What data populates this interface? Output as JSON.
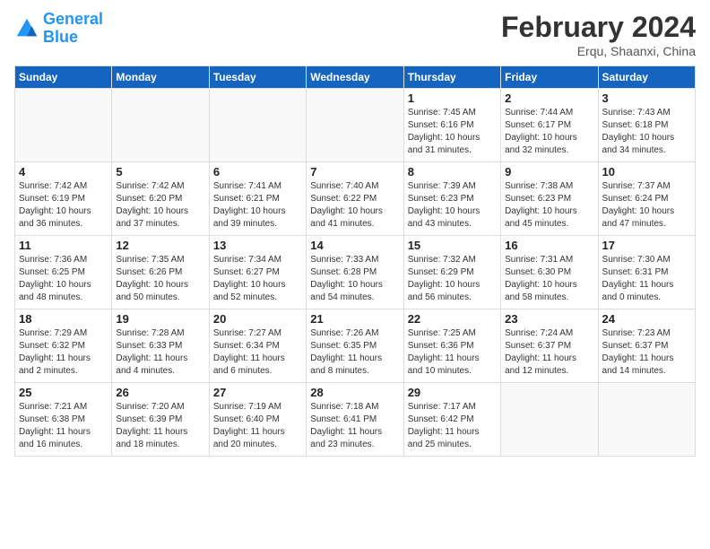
{
  "header": {
    "logo_line1": "General",
    "logo_line2": "Blue",
    "month": "February 2024",
    "location": "Erqu, Shaanxi, China"
  },
  "weekdays": [
    "Sunday",
    "Monday",
    "Tuesday",
    "Wednesday",
    "Thursday",
    "Friday",
    "Saturday"
  ],
  "weeks": [
    [
      {
        "day": "",
        "info": ""
      },
      {
        "day": "",
        "info": ""
      },
      {
        "day": "",
        "info": ""
      },
      {
        "day": "",
        "info": ""
      },
      {
        "day": "1",
        "info": "Sunrise: 7:45 AM\nSunset: 6:16 PM\nDaylight: 10 hours\nand 31 minutes."
      },
      {
        "day": "2",
        "info": "Sunrise: 7:44 AM\nSunset: 6:17 PM\nDaylight: 10 hours\nand 32 minutes."
      },
      {
        "day": "3",
        "info": "Sunrise: 7:43 AM\nSunset: 6:18 PM\nDaylight: 10 hours\nand 34 minutes."
      }
    ],
    [
      {
        "day": "4",
        "info": "Sunrise: 7:42 AM\nSunset: 6:19 PM\nDaylight: 10 hours\nand 36 minutes."
      },
      {
        "day": "5",
        "info": "Sunrise: 7:42 AM\nSunset: 6:20 PM\nDaylight: 10 hours\nand 37 minutes."
      },
      {
        "day": "6",
        "info": "Sunrise: 7:41 AM\nSunset: 6:21 PM\nDaylight: 10 hours\nand 39 minutes."
      },
      {
        "day": "7",
        "info": "Sunrise: 7:40 AM\nSunset: 6:22 PM\nDaylight: 10 hours\nand 41 minutes."
      },
      {
        "day": "8",
        "info": "Sunrise: 7:39 AM\nSunset: 6:23 PM\nDaylight: 10 hours\nand 43 minutes."
      },
      {
        "day": "9",
        "info": "Sunrise: 7:38 AM\nSunset: 6:23 PM\nDaylight: 10 hours\nand 45 minutes."
      },
      {
        "day": "10",
        "info": "Sunrise: 7:37 AM\nSunset: 6:24 PM\nDaylight: 10 hours\nand 47 minutes."
      }
    ],
    [
      {
        "day": "11",
        "info": "Sunrise: 7:36 AM\nSunset: 6:25 PM\nDaylight: 10 hours\nand 48 minutes."
      },
      {
        "day": "12",
        "info": "Sunrise: 7:35 AM\nSunset: 6:26 PM\nDaylight: 10 hours\nand 50 minutes."
      },
      {
        "day": "13",
        "info": "Sunrise: 7:34 AM\nSunset: 6:27 PM\nDaylight: 10 hours\nand 52 minutes."
      },
      {
        "day": "14",
        "info": "Sunrise: 7:33 AM\nSunset: 6:28 PM\nDaylight: 10 hours\nand 54 minutes."
      },
      {
        "day": "15",
        "info": "Sunrise: 7:32 AM\nSunset: 6:29 PM\nDaylight: 10 hours\nand 56 minutes."
      },
      {
        "day": "16",
        "info": "Sunrise: 7:31 AM\nSunset: 6:30 PM\nDaylight: 10 hours\nand 58 minutes."
      },
      {
        "day": "17",
        "info": "Sunrise: 7:30 AM\nSunset: 6:31 PM\nDaylight: 11 hours\nand 0 minutes."
      }
    ],
    [
      {
        "day": "18",
        "info": "Sunrise: 7:29 AM\nSunset: 6:32 PM\nDaylight: 11 hours\nand 2 minutes."
      },
      {
        "day": "19",
        "info": "Sunrise: 7:28 AM\nSunset: 6:33 PM\nDaylight: 11 hours\nand 4 minutes."
      },
      {
        "day": "20",
        "info": "Sunrise: 7:27 AM\nSunset: 6:34 PM\nDaylight: 11 hours\nand 6 minutes."
      },
      {
        "day": "21",
        "info": "Sunrise: 7:26 AM\nSunset: 6:35 PM\nDaylight: 11 hours\nand 8 minutes."
      },
      {
        "day": "22",
        "info": "Sunrise: 7:25 AM\nSunset: 6:36 PM\nDaylight: 11 hours\nand 10 minutes."
      },
      {
        "day": "23",
        "info": "Sunrise: 7:24 AM\nSunset: 6:37 PM\nDaylight: 11 hours\nand 12 minutes."
      },
      {
        "day": "24",
        "info": "Sunrise: 7:23 AM\nSunset: 6:37 PM\nDaylight: 11 hours\nand 14 minutes."
      }
    ],
    [
      {
        "day": "25",
        "info": "Sunrise: 7:21 AM\nSunset: 6:38 PM\nDaylight: 11 hours\nand 16 minutes."
      },
      {
        "day": "26",
        "info": "Sunrise: 7:20 AM\nSunset: 6:39 PM\nDaylight: 11 hours\nand 18 minutes."
      },
      {
        "day": "27",
        "info": "Sunrise: 7:19 AM\nSunset: 6:40 PM\nDaylight: 11 hours\nand 20 minutes."
      },
      {
        "day": "28",
        "info": "Sunrise: 7:18 AM\nSunset: 6:41 PM\nDaylight: 11 hours\nand 23 minutes."
      },
      {
        "day": "29",
        "info": "Sunrise: 7:17 AM\nSunset: 6:42 PM\nDaylight: 11 hours\nand 25 minutes."
      },
      {
        "day": "",
        "info": ""
      },
      {
        "day": "",
        "info": ""
      }
    ]
  ]
}
